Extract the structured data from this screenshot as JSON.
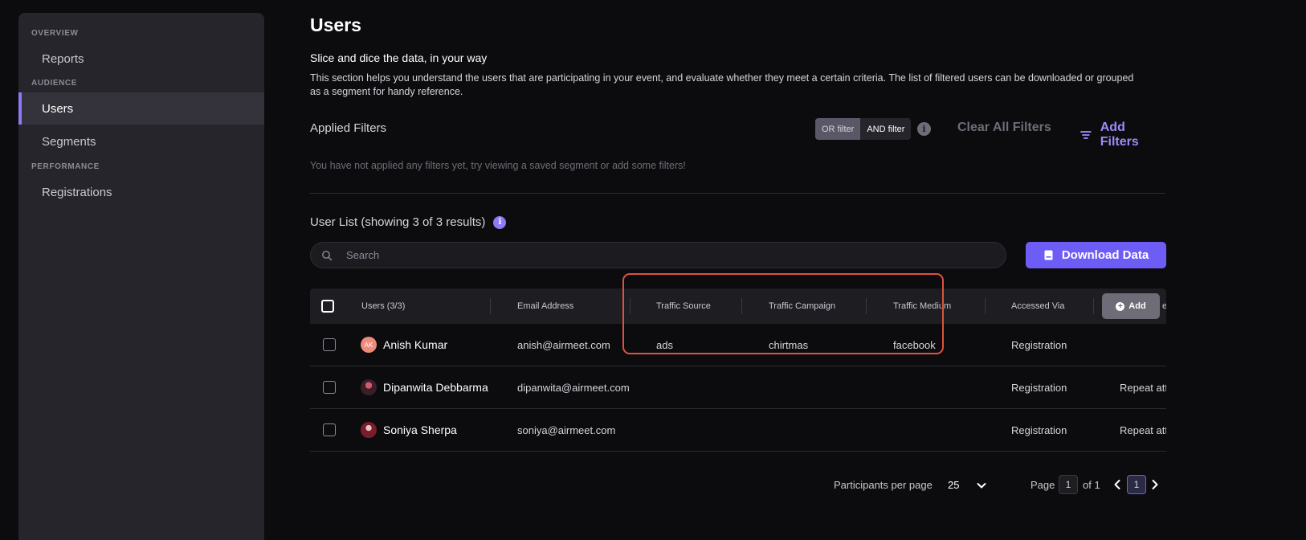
{
  "sidebar": {
    "sections": [
      {
        "label": "OVERVIEW"
      },
      {
        "label": "AUDIENCE"
      },
      {
        "label": "PERFORMANCE"
      }
    ],
    "items": [
      {
        "label": "Reports"
      },
      {
        "label": "Users"
      },
      {
        "label": "Segments"
      },
      {
        "label": "Registrations"
      }
    ],
    "active": "Users"
  },
  "header": {
    "title": "Users",
    "subtitle": "Slice and dice the data, in your way",
    "description": "This section helps you understand the users that are participating in your event, and evaluate whether they meet a certain criteria. The list of filtered users can be downloaded or grouped as a segment for handy reference."
  },
  "filters": {
    "label": "Applied Filters",
    "or_filter": "OR filter",
    "and_filter": "AND filter",
    "info": "i",
    "clear_all": "Clear All Filters",
    "add_filters": "Add Filters",
    "empty_message": "You have not applied any filters yet, try viewing a saved segment or add some filters!"
  },
  "user_list": {
    "title": "User List (showing 3 of 3 results)",
    "info": "i",
    "search_placeholder": "Search",
    "download_label": "Download Data"
  },
  "table": {
    "columns": [
      "Users (3/3)",
      "Email Address",
      "Traffic Source",
      "Traffic Campaign",
      "Traffic Medium",
      "Accessed Via"
    ],
    "add_column_label": "Add",
    "clipped_column_fragment": "e",
    "rows": [
      {
        "avatar_initials": "AK",
        "name": "Anish Kumar",
        "email": "anish@airmeet.com",
        "traffic_source": "ads",
        "traffic_campaign": "chirtmas",
        "traffic_medium": "facebook",
        "accessed_via": "Registration",
        "extra": ""
      },
      {
        "avatar_initials": "",
        "name": "Dipanwita Debbarma",
        "email": "dipanwita@airmeet.com",
        "traffic_source": "",
        "traffic_campaign": "",
        "traffic_medium": "",
        "accessed_via": "Registration",
        "extra": "Repeat att"
      },
      {
        "avatar_initials": "",
        "name": "Soniya Sherpa",
        "email": "soniya@airmeet.com",
        "traffic_source": "",
        "traffic_campaign": "",
        "traffic_medium": "",
        "accessed_via": "Registration",
        "extra": "Repeat att"
      }
    ]
  },
  "pagination": {
    "per_page_label": "Participants per page",
    "per_page_value": "25",
    "page_label": "Page",
    "page_input": "1",
    "of_label": "of 1",
    "current_page": "1"
  },
  "colors": {
    "accent": "#6d5cf5",
    "highlight_outline": "#e0523f",
    "background": "#0c0c0e",
    "sidebar": "#26252b"
  }
}
